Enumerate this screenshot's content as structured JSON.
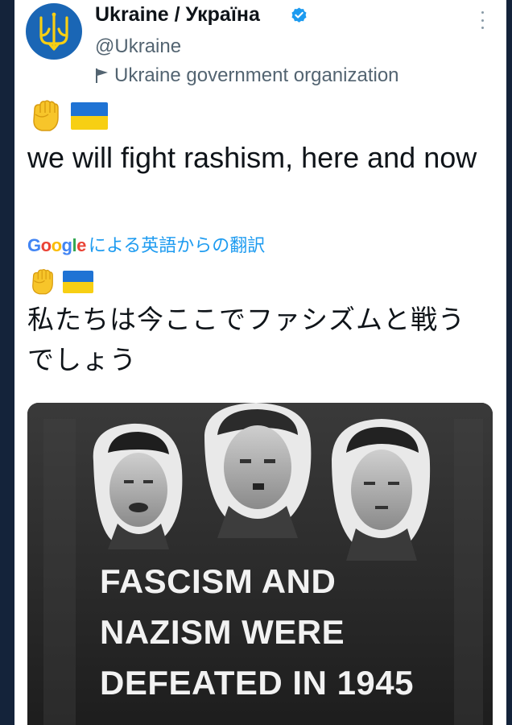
{
  "tweet": {
    "display_name": "Ukraine / Україна",
    "handle": "@Ukraine",
    "account_label": "Ukraine government organization",
    "text": "we will fight rashism, here and now",
    "translate_label": "による英語からの翻訳",
    "translated_text": "私たちは今ここでファシズムと戦うでしょう",
    "icons": {
      "avatar": "ukraine-trident-icon",
      "verified": "verified-badge-icon",
      "label": "flag-icon",
      "menu": "more-options-icon",
      "emoji_fist": "raised-fist-emoji",
      "emoji_flag": "ukraine-flag-emoji"
    }
  },
  "google_logo": [
    {
      "char": "G",
      "color": "#4285f4"
    },
    {
      "char": "o",
      "color": "#ea4335"
    },
    {
      "char": "o",
      "color": "#fbbc05"
    },
    {
      "char": "g",
      "color": "#4285f4"
    },
    {
      "char": "l",
      "color": "#34a853"
    },
    {
      "char": "e",
      "color": "#ea4335"
    }
  ],
  "media": {
    "caption_lines": [
      "FASCISM AND",
      "NAZISM WERE",
      "DEFEATED IN 1945"
    ]
  },
  "colors": {
    "background": "#14233a",
    "avatar": "#1a66b5",
    "trident": "#f7cf13",
    "verified": "#1d9bf0",
    "link": "#1d9bf0",
    "flag_blue": "#1f73d4",
    "flag_yellow": "#f7cf13"
  }
}
